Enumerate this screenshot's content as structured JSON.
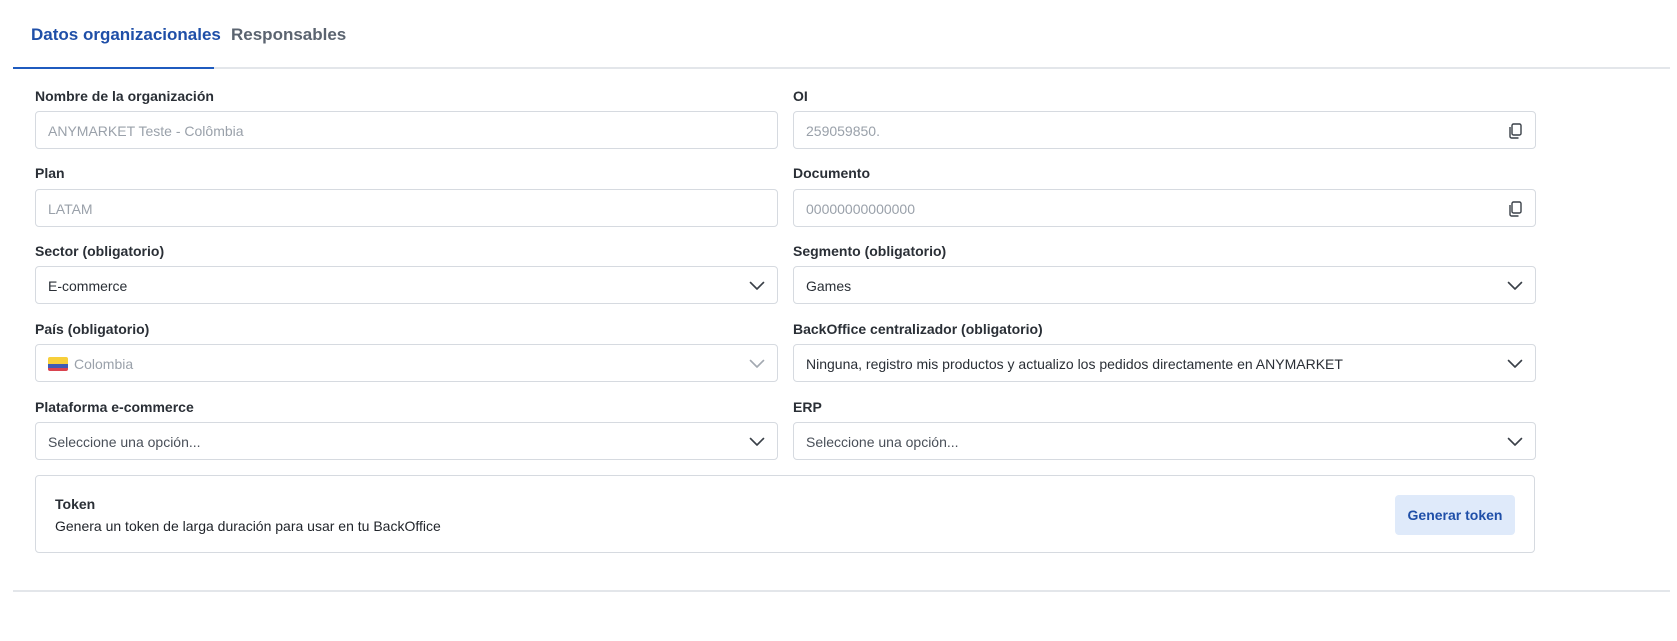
{
  "tabs": [
    {
      "label": "Datos organizacionales",
      "active": true
    },
    {
      "label": "Responsables",
      "active": false
    }
  ],
  "fields": {
    "org_name": {
      "label": "Nombre de la organización",
      "value": "ANYMARKET Teste - Colômbia"
    },
    "oi": {
      "label": "OI",
      "value": "259059850.",
      "icon": "copy-icon"
    },
    "plan": {
      "label": "Plan",
      "value": "LATAM"
    },
    "documento": {
      "label": "Documento",
      "value": "00000000000000",
      "icon": "copy-icon"
    },
    "sector": {
      "label": "Sector (obligatorio)",
      "value": "E-commerce"
    },
    "segmento": {
      "label": "Segmento (obligatorio)",
      "value": "Games"
    },
    "pais": {
      "label": "País (obligatorio)",
      "value": "Colombia",
      "flag": "colombia-flag-icon"
    },
    "backoffice": {
      "label": "BackOffice centralizador (obligatorio)",
      "value": "Ninguna, registro mis productos y actualizo los pedidos directamente en ANYMARKET"
    },
    "plataforma": {
      "label": "Plataforma e-commerce",
      "placeholder": "Seleccione una opción..."
    },
    "erp": {
      "label": "ERP",
      "placeholder": "Seleccione una opción..."
    }
  },
  "token": {
    "title": "Token",
    "description": "Genera un token de larga duración para usar en tu BackOffice",
    "button_label": "Generar token"
  },
  "colors": {
    "accent": "#1f4fa8",
    "button_bg": "#dfeafa",
    "border": "#d6dae0"
  }
}
